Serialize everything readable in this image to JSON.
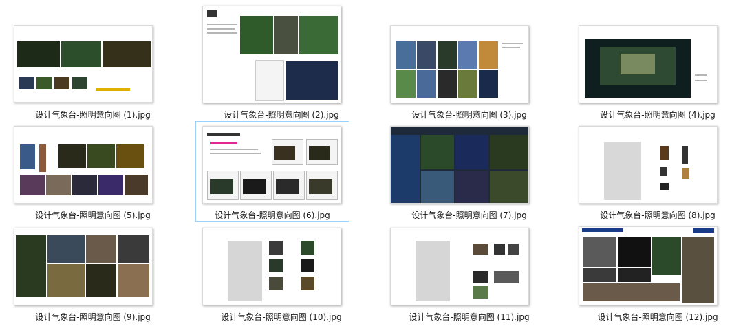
{
  "window": {
    "view": "large-icons"
  },
  "files": [
    {
      "name": "设计气象台-照明意向图 (1).jpg",
      "selected": false
    },
    {
      "name": "设计气象台-照明意向图 (2).jpg",
      "selected": false
    },
    {
      "name": "设计气象台-照明意向图 (3).jpg",
      "selected": false
    },
    {
      "name": "设计气象台-照明意向图 (4).jpg",
      "selected": false
    },
    {
      "name": "设计气象台-照明意向图 (5).jpg",
      "selected": false
    },
    {
      "name": "设计气象台-照明意向图 (6).jpg",
      "selected": true
    },
    {
      "name": "设计气象台-照明意向图 (7).jpg",
      "selected": false
    },
    {
      "name": "设计气象台-照明意向图 (8).jpg",
      "selected": false
    },
    {
      "name": "设计气象台-照明意向图 (9).jpg",
      "selected": false
    },
    {
      "name": "设计气象台-照明意向图 (10).jpg",
      "selected": false
    },
    {
      "name": "设计气象台-照明意向图 (11).jpg",
      "selected": false
    },
    {
      "name": "设计气象台-照明意向图 (12).jpg",
      "selected": false
    }
  ],
  "colors": {
    "selection_border": "#99d1ff",
    "thumbnail_shadow": "#b0b0b0"
  }
}
